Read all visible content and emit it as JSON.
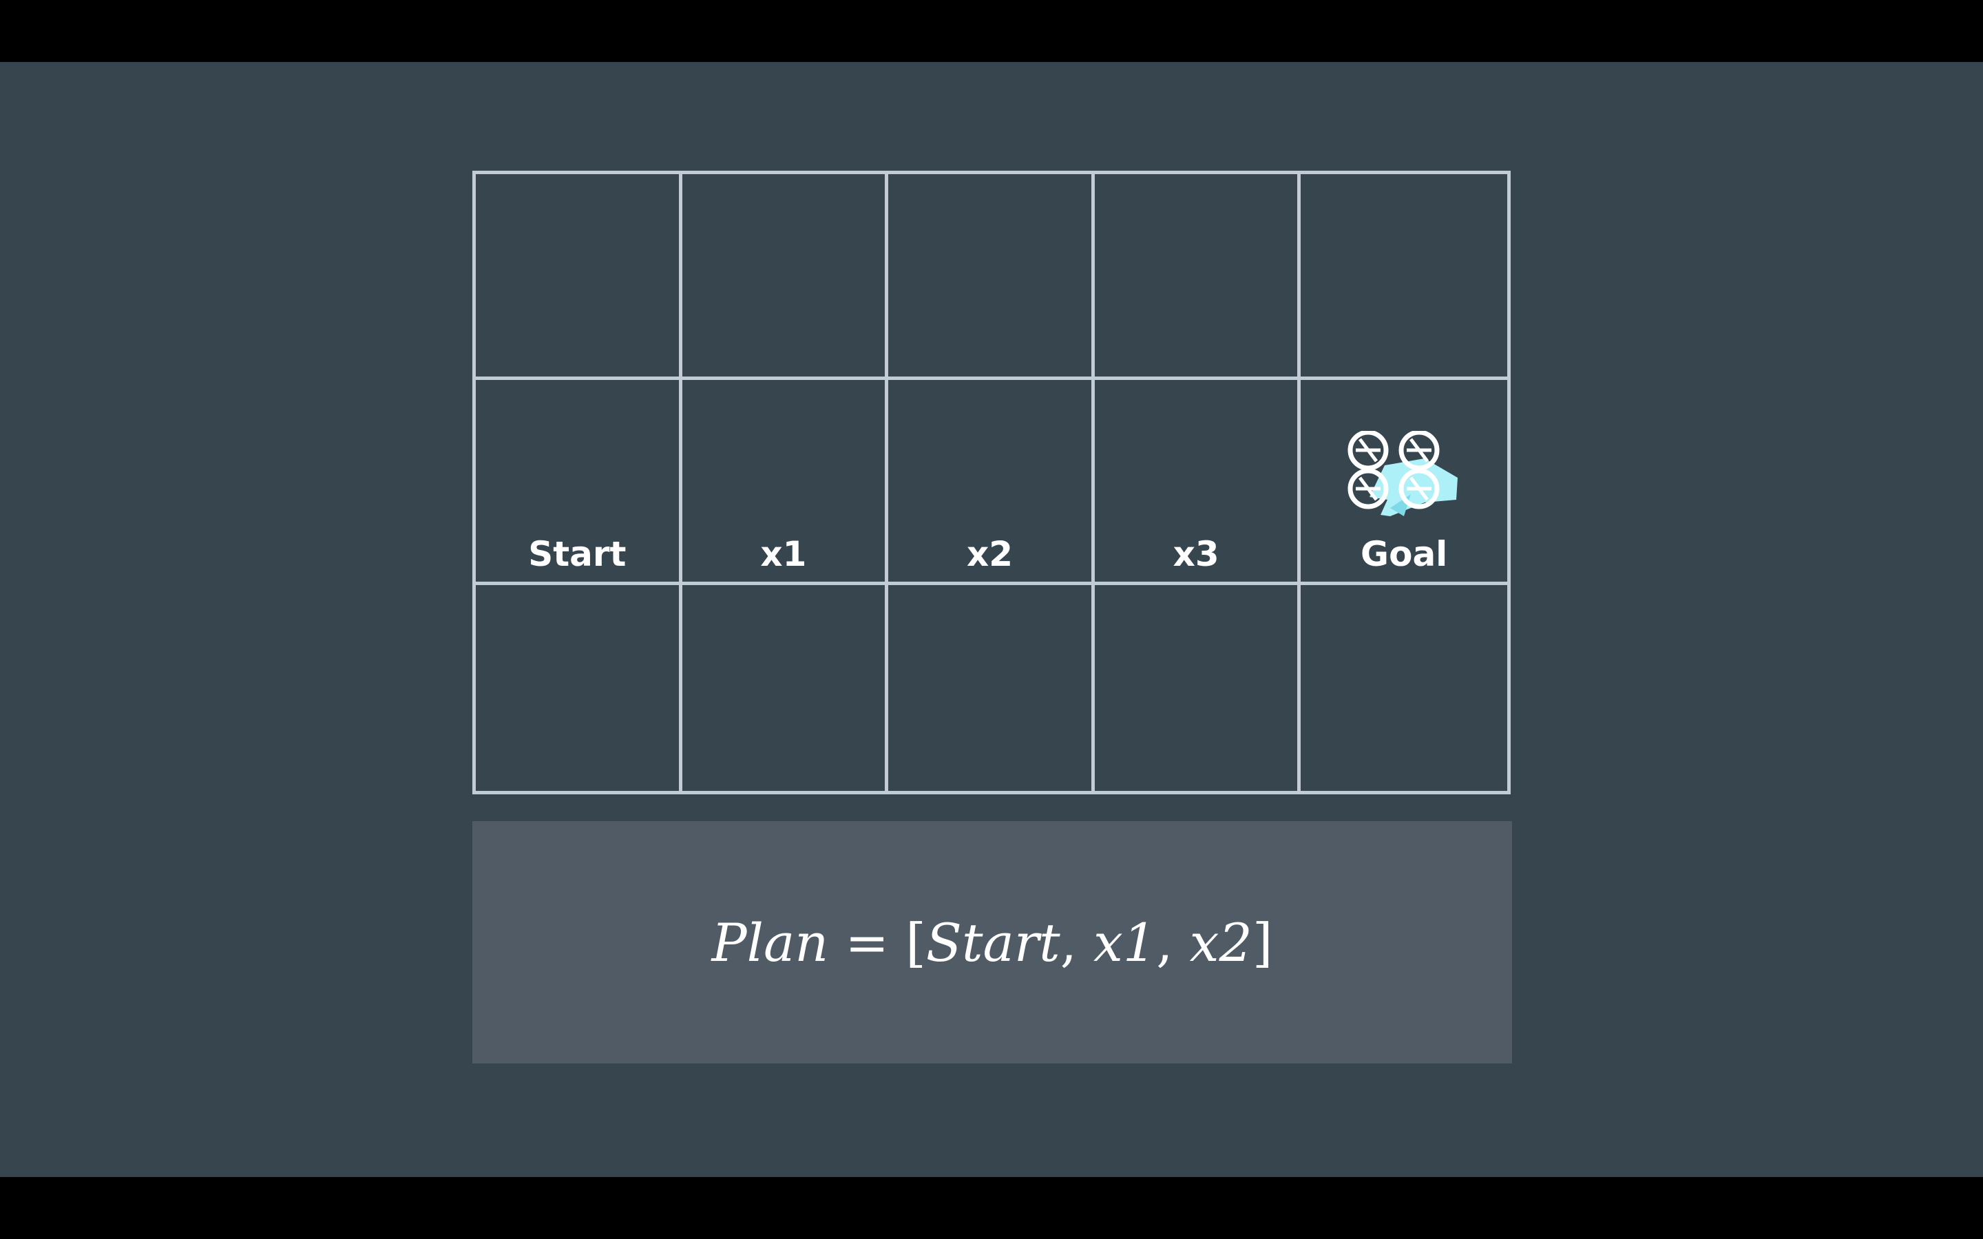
{
  "grid": {
    "rows": 3,
    "columns": 5,
    "labels": [
      "Start",
      "x1",
      "x2",
      "x3",
      "Goal"
    ],
    "drone_cell": "Goal"
  },
  "plan": {
    "lhs": "Plan",
    "equals": "=",
    "open_bracket": "[",
    "items": [
      "Start",
      "x1",
      "x2"
    ],
    "separator": ",",
    "close_bracket": "]"
  },
  "colors": {
    "background": "#37454f",
    "grid_line": "#c3ccd6",
    "plan_box": "#505b66",
    "drone_body": "#aef0f7",
    "text": "#ffffff"
  },
  "icons": {
    "drone": "quadcopter-drone-icon"
  }
}
